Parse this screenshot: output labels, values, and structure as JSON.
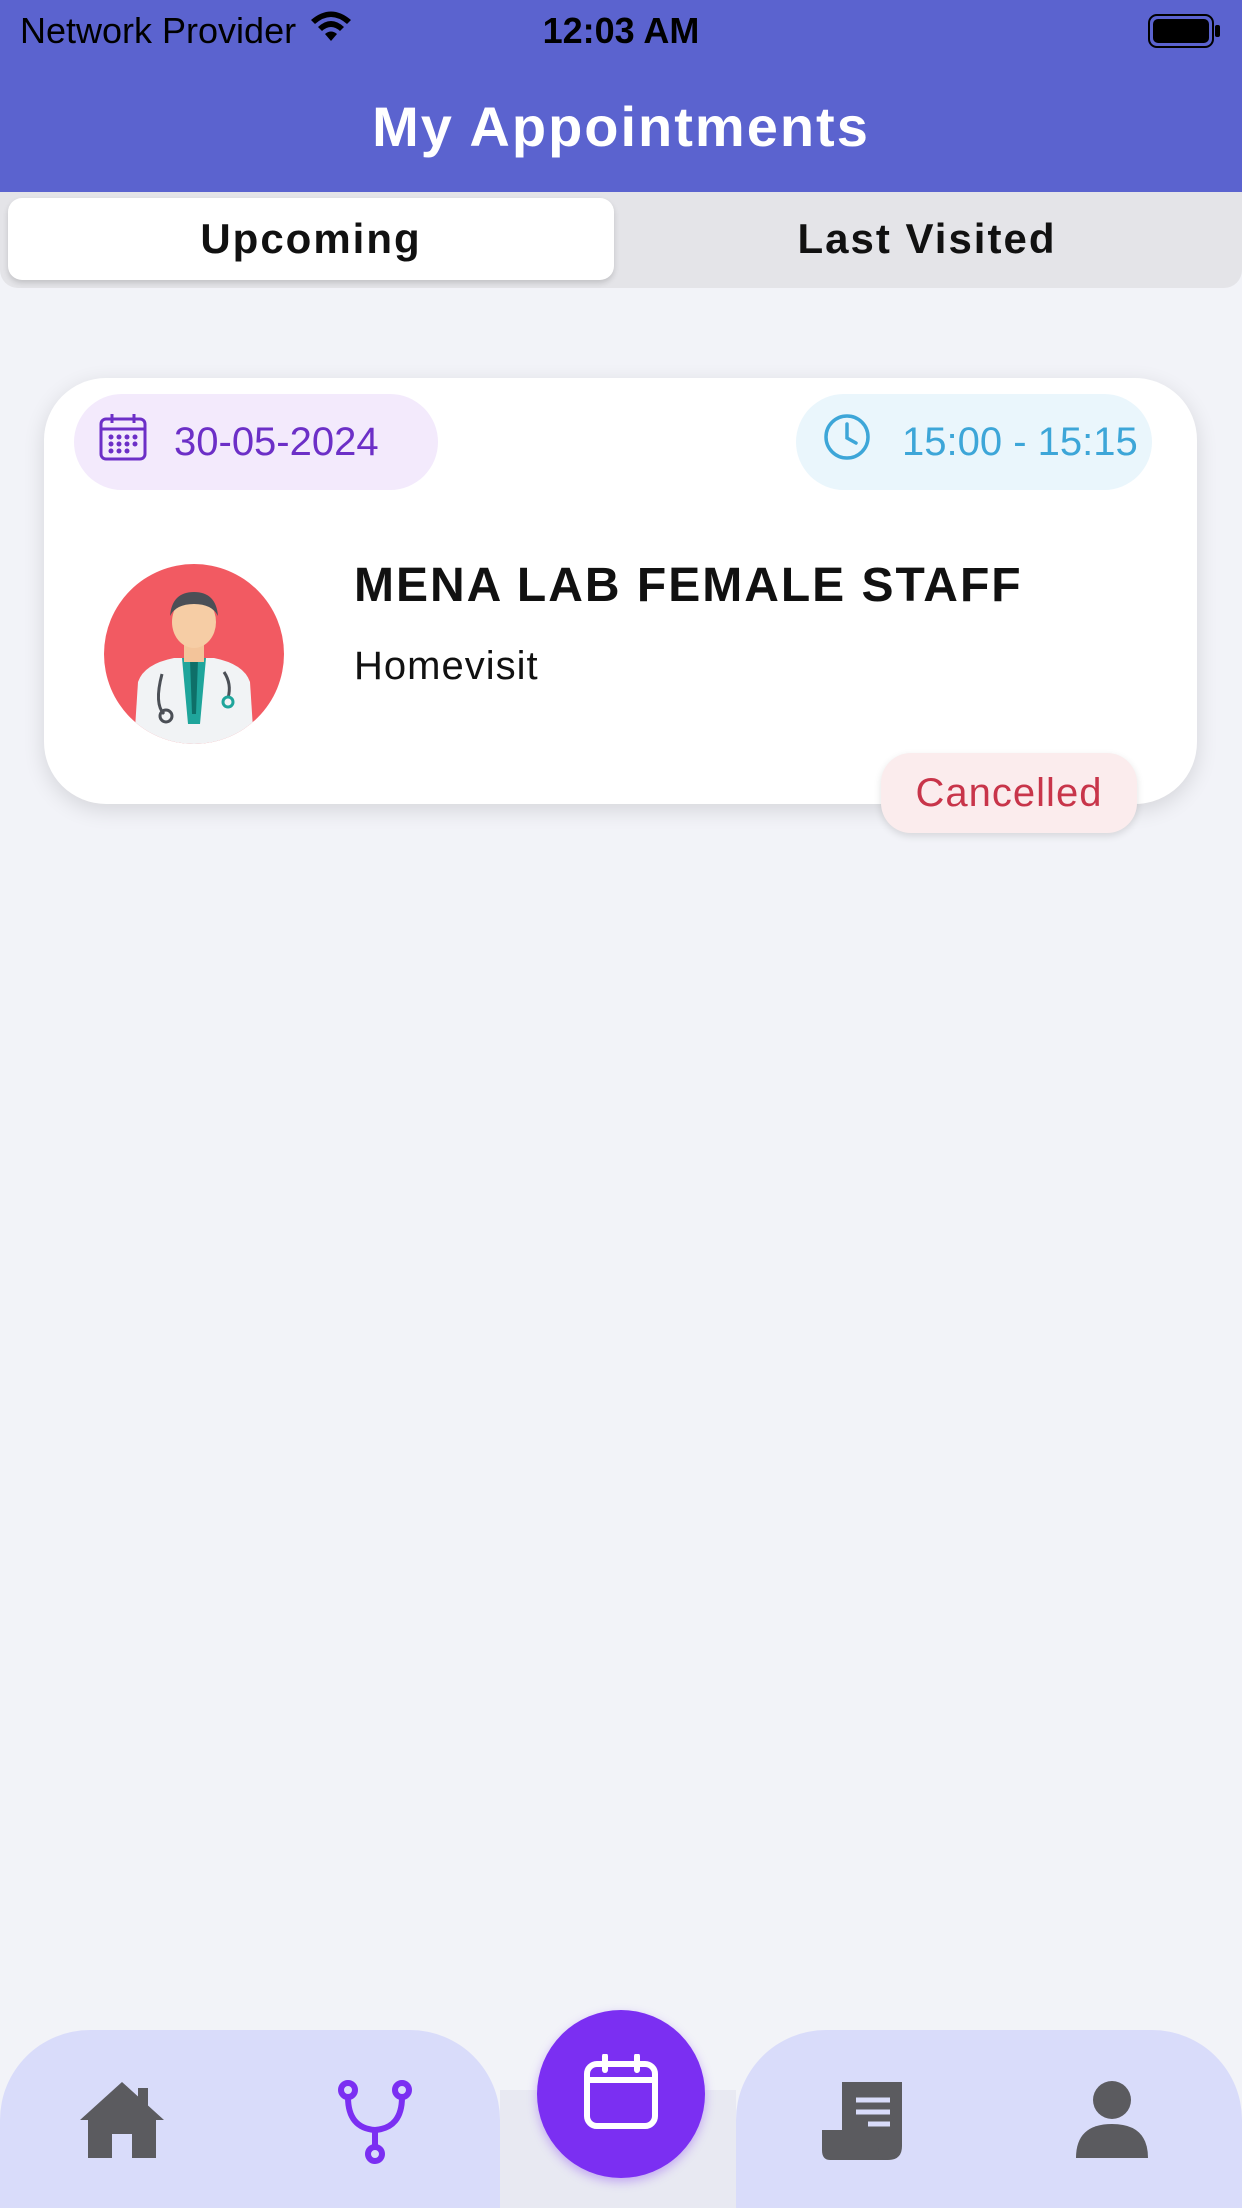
{
  "status_bar": {
    "carrier": "Network Provider",
    "time": "12:03 AM"
  },
  "header": {
    "title": "My Appointments"
  },
  "tabs": [
    {
      "label": "Upcoming",
      "active": true
    },
    {
      "label": "Last Visited",
      "active": false
    }
  ],
  "appointment": {
    "date": "30-05-2024",
    "time": "15:00 - 15:15",
    "provider": "MENA LAB FEMALE STAFF",
    "visit_type": "Homevisit",
    "status": "Cancelled"
  },
  "bottom_nav": {
    "items": [
      "home-icon",
      "stethoscope-icon",
      "calendar-icon",
      "receipt-icon",
      "person-icon"
    ],
    "active": "calendar-icon"
  },
  "colors": {
    "header_bg": "#5b63cf",
    "accent_purple": "#7b2ff2",
    "date_text": "#6c2fc7",
    "time_text": "#3da6d8",
    "cancelled": "#c8354a",
    "nav_bg": "#d9dcfa"
  }
}
